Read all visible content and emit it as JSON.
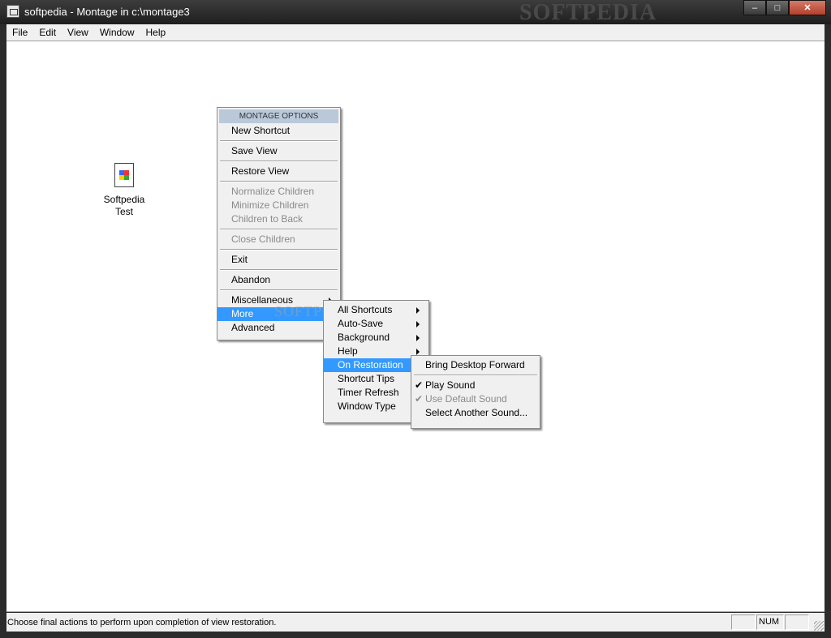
{
  "window": {
    "title": "softpedia - Montage in c:\\montage3",
    "watermark": "SOFTPEDIA",
    "buttons": {
      "minimize": "–",
      "maximize": "□",
      "close": "✕"
    }
  },
  "menubar": [
    "File",
    "Edit",
    "View",
    "Window",
    "Help"
  ],
  "desktop_icon": {
    "label_line1": "Softpedia",
    "label_line2": "Test",
    "icon": "document-icon"
  },
  "options_menu": {
    "header": "MONTAGE OPTIONS",
    "items": [
      "New Shortcut",
      "Save View",
      "Restore View",
      "Normalize Children",
      "Minimize Children",
      "Children to Back",
      "Close Children",
      "Exit",
      "Abandon",
      "Miscellaneous",
      "More",
      "Advanced"
    ]
  },
  "more_menu": {
    "items": [
      "All Shortcuts",
      "Auto-Save",
      "Background",
      "Help",
      "On Restoration",
      "Shortcut Tips",
      "Timer Refresh",
      "Window Type"
    ]
  },
  "restoration_menu": {
    "items": [
      "Bring Desktop Forward",
      "Play Sound",
      "Use Default Sound",
      "Select Another Sound..."
    ]
  },
  "statusbar": {
    "text": "Choose final actions to perform upon completion of view restoration.",
    "num": "NUM"
  },
  "colors": {
    "highlight": "#3399ff",
    "menu_bg": "#f0f0f0",
    "header_bg": "#b9c9da"
  }
}
